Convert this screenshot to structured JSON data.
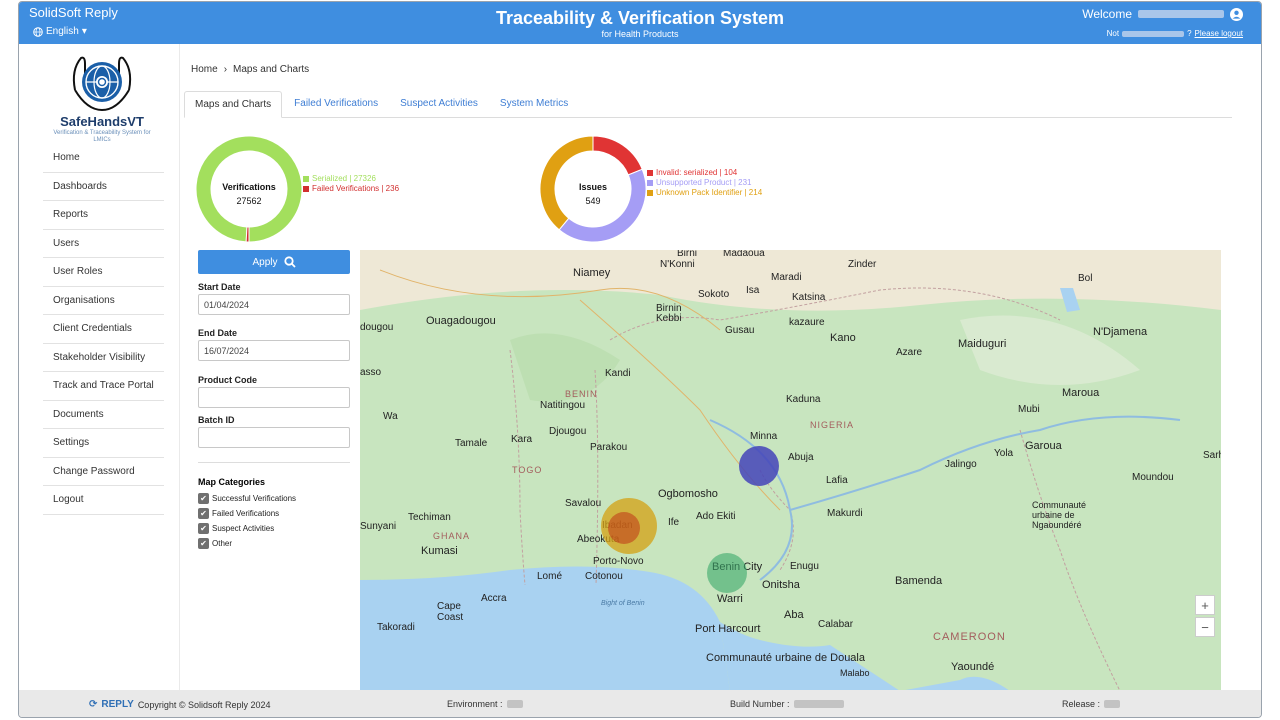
{
  "header": {
    "brand": "SolidSoft Reply",
    "language": "English",
    "title": "Traceability & Verification System",
    "subtitle": "for Health Products",
    "welcome": "Welcome",
    "not_prefix": "Not",
    "logout_link": "Please logout"
  },
  "logo": {
    "name": "SafeHandsVT",
    "tagline": "Verification & Traceability System for LMICs"
  },
  "sidebar": {
    "items": [
      {
        "label": "Home"
      },
      {
        "label": "Dashboards"
      },
      {
        "label": "Reports"
      },
      {
        "label": "Users"
      },
      {
        "label": "User Roles"
      },
      {
        "label": "Organisations"
      },
      {
        "label": "Client Credentials"
      },
      {
        "label": "Stakeholder Visibility"
      },
      {
        "label": "Track and Trace Portal"
      },
      {
        "label": "Documents"
      },
      {
        "label": "Settings"
      },
      {
        "label": "Change Password"
      },
      {
        "label": "Logout"
      }
    ]
  },
  "breadcrumb": {
    "home": "Home",
    "separator": "›",
    "current": "Maps and Charts"
  },
  "tabs": [
    {
      "label": "Maps and Charts"
    },
    {
      "label": "Failed Verifications"
    },
    {
      "label": "Suspect Activities"
    },
    {
      "label": "System Metrics"
    }
  ],
  "verifications_chart": {
    "title": "Verifications",
    "total": "27562",
    "legend": [
      {
        "label": "Serialized | 27326",
        "color": "#a3df5d",
        "value": 27326
      },
      {
        "label": "Failed Verifications | 236",
        "color": "#d12f2f",
        "value": 236
      }
    ]
  },
  "issues_chart": {
    "title": "Issues",
    "total": "549",
    "legend": [
      {
        "label": "Invalid: serialized | 104",
        "color": "#e03434",
        "value": 104
      },
      {
        "label": "Unsupported Product | 231",
        "color": "#a59df5",
        "value": 231
      },
      {
        "label": "Unknown Pack Identifier | 214",
        "color": "#e0a012",
        "value": 214
      }
    ]
  },
  "filters": {
    "apply_label": "Apply",
    "start_date_label": "Start Date",
    "start_date_value": "01/04/2024",
    "end_date_label": "End Date",
    "end_date_value": "16/07/2024",
    "product_code_label": "Product Code",
    "product_code_value": "",
    "batch_id_label": "Batch ID",
    "batch_id_value": ""
  },
  "map_categories": {
    "title": "Map Categories",
    "items": [
      {
        "label": "Successful Verifications",
        "checked": true
      },
      {
        "label": "Failed Verifications",
        "checked": true
      },
      {
        "label": "Suspect Activities",
        "checked": true
      },
      {
        "label": "Other",
        "checked": true
      }
    ]
  },
  "map": {
    "labels": {
      "birni": "Birni",
      "nkonni": "N'Konni",
      "madaoua": "Madaoua",
      "zinder": "Zinder",
      "bol": "Bol",
      "niamey": "Niamey",
      "maradi": "Maradi",
      "sokoto": "Sokoto",
      "isa": "Isa",
      "katsina": "Katsina",
      "birnin": "Birnin",
      "kebbi": "Kebbi",
      "gusau": "Gusau",
      "kazaure": "kazaure",
      "kano": "Kano",
      "ouagadougou": "Ouagadougou",
      "dougou": "dougou",
      "ndjamena": "N'Djamena",
      "azare": "Azare",
      "maiduguri": "Maiduguri",
      "asso": "asso",
      "kandi": "Kandi",
      "benin": "BENIN",
      "natitingou": "Natitingou",
      "kaduna": "Kaduna",
      "mubi": "Mubi",
      "maroua": "Maroua",
      "wa": "Wa",
      "nigeria": "NIGERIA",
      "tamale": "Tamale",
      "kara": "Kara",
      "djougou": "Djougou",
      "parakou": "Parakou",
      "minna": "Minna",
      "abuja": "Abuja",
      "yola": "Yola",
      "garoua": "Garoua",
      "jalingo": "Jalingo",
      "sarh": "Sarh",
      "togo": "TOGO",
      "lafia": "Lafia",
      "moundou": "Moundou",
      "savalou": "Savalou",
      "ogbomosho": "Ogbomosho",
      "makurdi": "Makurdi",
      "communaute_ngaoundere": "Communauté urbaine de Ngaoundéré",
      "techiman": "Techiman",
      "ibadan": "Ibadan",
      "ife": "Ife",
      "ado_ekiti": "Ado Ekiti",
      "sunyani": "Sunyani",
      "ghana": "GHANA",
      "abeokuta": "Abeokuta",
      "kumasi": "Kumasi",
      "porto_novo": "Porto-Novo",
      "benin_city": "Benin City",
      "enugu": "Enugu",
      "lome": "Lomé",
      "cotonou": "Cotonou",
      "onitsha": "Onitsha",
      "bamenda": "Bamenda",
      "accra": "Accra",
      "warri": "Warri",
      "cape_coast": "Cape Coast",
      "bight": "Bight of Benin",
      "takoradi": "Takoradi",
      "aba": "Aba",
      "calabar": "Calabar",
      "port_harcourt": "Port Harcourt",
      "cameroon": "CAMEROON",
      "douala": "Communauté urbaine de Douala",
      "malabo": "Malabo",
      "yaounde": "Yaoundé"
    },
    "zoom_in": "+",
    "zoom_out": "−"
  },
  "footer": {
    "copyright": "Copyright © Solidsoft Reply 2024",
    "reply": "REPLY",
    "environment_label": "Environment :",
    "build_label": "Build Number :",
    "release_label": "Release :"
  },
  "colors": {
    "header": "#3f8ee0",
    "link": "#3f7ed4",
    "bubble_successful": "#3aa86a",
    "bubble_failed": "#c0401a",
    "bubble_suspect": "#4444b8",
    "bubble_other": "#d4a013"
  }
}
